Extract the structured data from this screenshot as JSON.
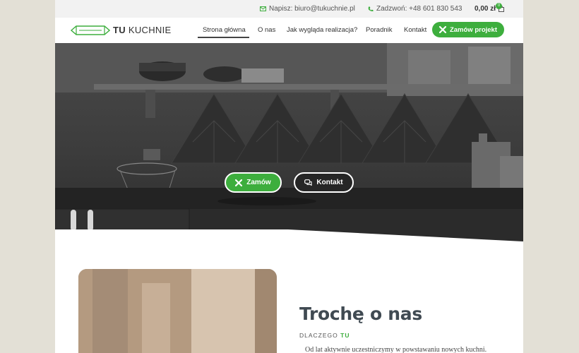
{
  "topbar": {
    "email_label": "Napisz: biuro@tukuchnie.pl",
    "phone_label": "Zadzwoń: +48 601 830 543",
    "cart_total": "0,00 zł",
    "cart_count": "0"
  },
  "logo": {
    "bold": "TU",
    "light": "KUCHNIE"
  },
  "nav": {
    "items": [
      {
        "label": "Strona główna",
        "active": true
      },
      {
        "label": "O nas"
      },
      {
        "label": "Jak wygląda realizacja?"
      },
      {
        "label": "Poradnik"
      },
      {
        "label": "Kontakt"
      }
    ],
    "cta_label": "Zamów projekt"
  },
  "hero": {
    "primary_button": "Zamów",
    "secondary_button": "Kontakt"
  },
  "about": {
    "title": "Trochę o nas",
    "subtitle_prefix": "DLACZEGO",
    "subtitle_accent": "TU",
    "text": "Od lat aktywnie uczestniczymy w powstawaniu nowych kuchni."
  },
  "colors": {
    "accent": "#3dae3d",
    "outer_background": "#e3e0d6",
    "topbar_background": "#f2f2f2"
  }
}
